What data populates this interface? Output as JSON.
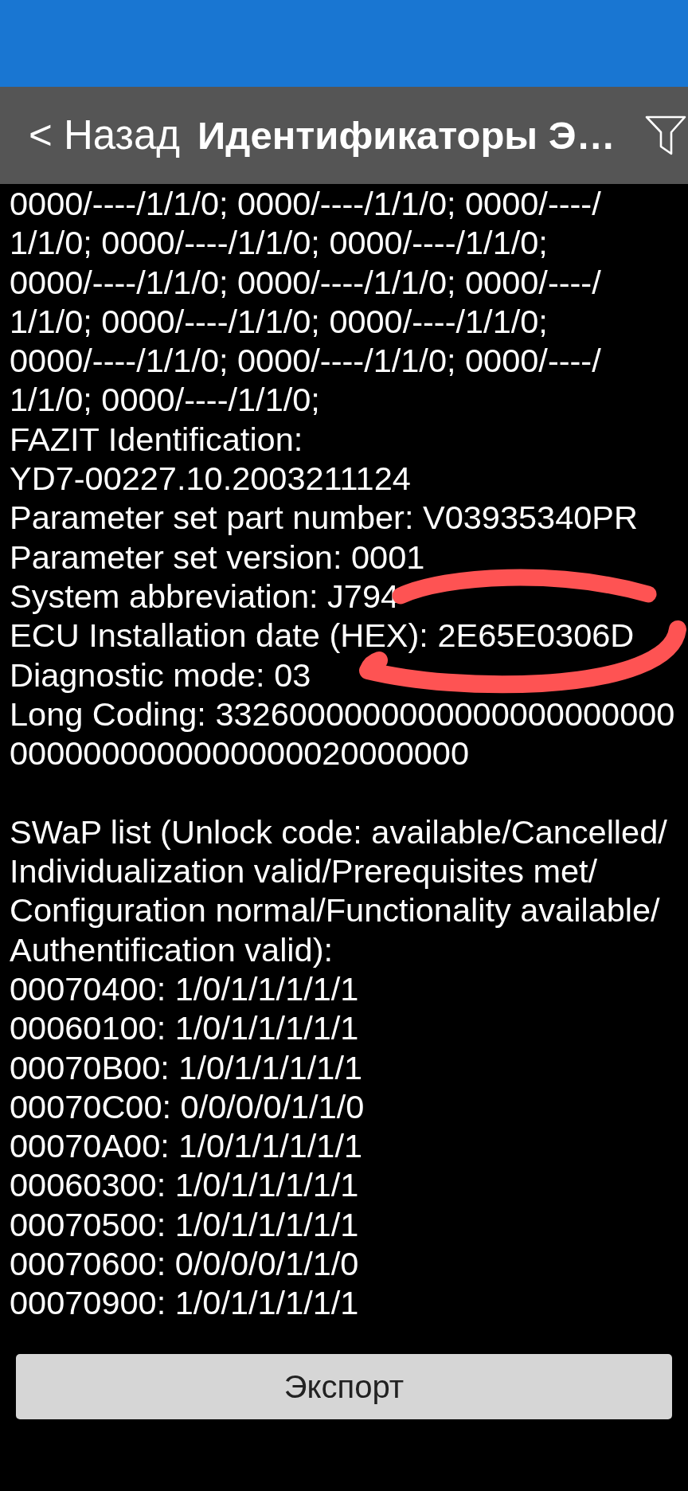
{
  "header": {
    "back": "< Назад",
    "title": "Идентификаторы Э…"
  },
  "details": {
    "sections": [
      [
        {
          "lines": [
            "0000/----/1/1/0; 0000/----/1/1/0; 0000/----/",
            "1/1/0; 0000/----/1/1/0; 0000/----/1/1/0;",
            "0000/----/1/1/0; 0000/----/1/1/0; 0000/----/",
            "1/1/0; 0000/----/1/1/0; 0000/----/1/1/0;",
            "0000/----/1/1/0; 0000/----/1/1/0; 0000/----/",
            "1/1/0; 0000/----/1/1/0;"
          ]
        },
        {
          "lines": [
            "FAZIT Identification:",
            "YD7-00227.10.2003211124"
          ]
        },
        {
          "lines": [
            "Parameter set part number: V03935340PR"
          ]
        },
        {
          "lines": [
            "Parameter set version: 0001"
          ]
        },
        {
          "lines": [
            "System abbreviation: J794"
          ]
        },
        {
          "lines": [
            "ECU Installation date (HEX): 2E65E0306D"
          ]
        },
        {
          "lines": [
            "Diagnostic mode: 03"
          ]
        },
        {
          "lines": [
            "Long Coding: 3326000000000000000000000",
            "0000000000000000020000000"
          ]
        }
      ],
      [
        {
          "lines": [
            "SWaP list (Unlock code: available/Cancelled/",
            "Individualization valid/Prerequisites met/",
            "Configuration normal/Functionality available/",
            "Authentification valid):"
          ]
        },
        {
          "lines": [
            "00070400: 1/0/1/1/1/1/1"
          ]
        },
        {
          "lines": [
            "00060100: 1/0/1/1/1/1/1"
          ]
        },
        {
          "lines": [
            "00070B00: 1/0/1/1/1/1/1"
          ]
        },
        {
          "lines": [
            "00070C00: 0/0/0/0/1/1/0"
          ]
        },
        {
          "lines": [
            "00070A00: 1/0/1/1/1/1/1"
          ]
        },
        {
          "lines": [
            "00060300: 1/0/1/1/1/1/1"
          ]
        },
        {
          "lines": [
            "00070500: 1/0/1/1/1/1/1"
          ]
        },
        {
          "lines": [
            "00070600: 0/0/0/0/1/1/0"
          ]
        },
        {
          "lines": [
            "00070900: 1/0/1/1/1/1/1"
          ]
        }
      ]
    ]
  },
  "footer": {
    "button": "Экспорт"
  }
}
